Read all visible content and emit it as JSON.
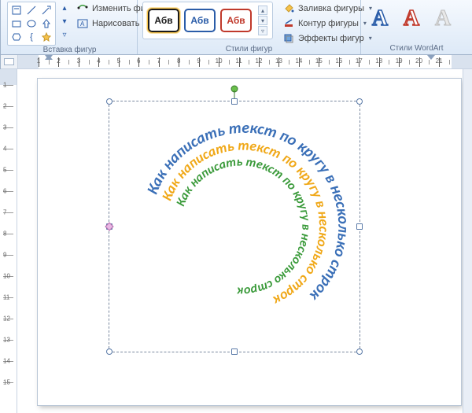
{
  "ribbon": {
    "insert_shapes": {
      "label": "Вставка фигур",
      "edit_shape": "Изменить фигуру",
      "text_box": "Нарисовать надпись"
    },
    "shape_styles": {
      "label": "Стили фигур",
      "sample": "Абв",
      "fill": "Заливка фигуры",
      "outline": "Контур фигуры",
      "effects": "Эффекты фигур"
    },
    "wordart_styles": {
      "label": "Стили WordArt",
      "glyph": "A"
    }
  },
  "ruler": {
    "units": [
      1,
      2,
      3,
      4,
      5,
      6,
      7,
      8,
      9,
      10,
      11,
      12,
      13,
      14,
      15,
      16,
      17,
      18,
      19,
      20,
      21
    ]
  },
  "vruler_units": [
    1,
    2,
    3,
    4,
    5,
    6,
    7,
    8,
    9,
    10,
    11,
    12,
    13,
    14,
    15
  ],
  "wordart": {
    "line1": "Как написать текст по кругу в несколько строк",
    "line2": "Как написать текст по кругу в несколько строк",
    "line3": "Как написать текст по кругу в несколько строк"
  }
}
